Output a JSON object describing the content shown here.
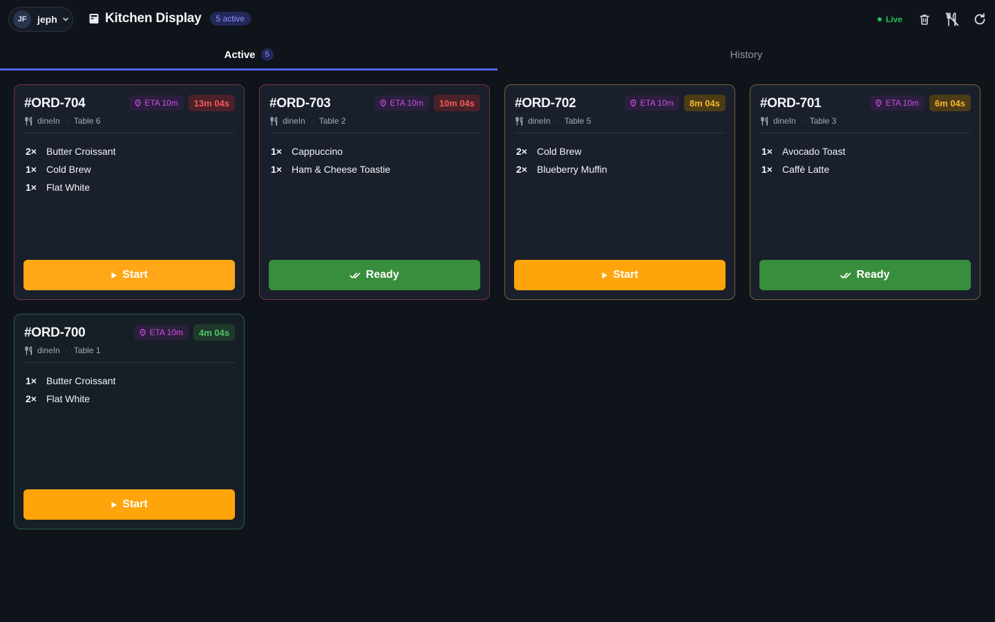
{
  "header": {
    "user_initials": "JF",
    "user_name": "jeph",
    "app_title": "Kitchen Display",
    "active_badge": "5 active",
    "live_label": "Live",
    "icons": [
      "trash-icon",
      "no-utensils-icon",
      "refresh-icon"
    ]
  },
  "tabs": [
    {
      "label": "Active",
      "count": "5",
      "selected": true
    },
    {
      "label": "History",
      "selected": false
    }
  ],
  "colors": {
    "accent": "#5b66e8",
    "start_button": "#ffa40a",
    "ready_button": "#388e3c",
    "eta": "#cf4fe0",
    "live": "#22c55e"
  },
  "orders": [
    {
      "id": "#ORD-704",
      "eta": "ETA 10m",
      "elapsed": "13m 04s",
      "urgency": "late",
      "service": "dineIn",
      "table": "Table 6",
      "items": [
        {
          "qty": "2×",
          "name": "Butter Croissant"
        },
        {
          "qty": "1×",
          "name": "Cold Brew"
        },
        {
          "qty": "1×",
          "name": "Flat White"
        }
      ],
      "action": "Start"
    },
    {
      "id": "#ORD-703",
      "eta": "ETA 10m",
      "elapsed": "10m 04s",
      "urgency": "late",
      "service": "dineIn",
      "table": "Table 2",
      "items": [
        {
          "qty": "1×",
          "name": "Cappuccino"
        },
        {
          "qty": "1×",
          "name": "Ham & Cheese Toastie"
        }
      ],
      "action": "Ready"
    },
    {
      "id": "#ORD-702",
      "eta": "ETA 10m",
      "elapsed": "8m 04s",
      "urgency": "warning",
      "service": "dineIn",
      "table": "Table 5",
      "items": [
        {
          "qty": "2×",
          "name": "Cold Brew"
        },
        {
          "qty": "2×",
          "name": "Blueberry Muffin"
        }
      ],
      "action": "Start"
    },
    {
      "id": "#ORD-701",
      "eta": "ETA 10m",
      "elapsed": "6m 04s",
      "urgency": "warning",
      "service": "dineIn",
      "table": "Table 3",
      "items": [
        {
          "qty": "1×",
          "name": "Avocado Toast"
        },
        {
          "qty": "1×",
          "name": "Caffè Latte"
        }
      ],
      "action": "Ready"
    },
    {
      "id": "#ORD-700",
      "eta": "ETA 10m",
      "elapsed": "4m 04s",
      "urgency": "ok",
      "service": "dineIn",
      "table": "Table 1",
      "items": [
        {
          "qty": "1×",
          "name": "Butter Croissant"
        },
        {
          "qty": "2×",
          "name": "Flat White"
        }
      ],
      "action": "Start"
    }
  ]
}
